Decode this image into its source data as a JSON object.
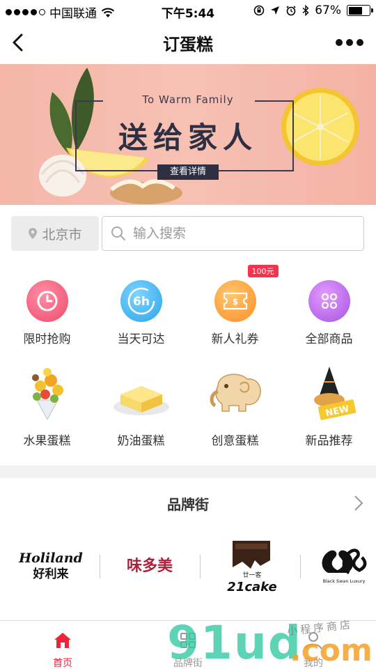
{
  "status": {
    "carrier": "中国联通",
    "time": "下午5:44",
    "battery": "67%",
    "battery_level": 0.67
  },
  "nav": {
    "title": "订蛋糕"
  },
  "banner": {
    "en": "To Warm Family",
    "cn": "送给家人",
    "button": "查看详情"
  },
  "search": {
    "city": "北京市",
    "placeholder": "输入搜索"
  },
  "categories": [
    {
      "label": "限时抢购",
      "icon": "clock-icon",
      "color": "#f25d7a"
    },
    {
      "label": "当天可达",
      "icon": "6h-icon",
      "color": "#3ab4ee",
      "icon_text": "6h"
    },
    {
      "label": "新人礼券",
      "icon": "coupon-icon",
      "color": "#ff9f3a",
      "badge": "100元"
    },
    {
      "label": "全部商品",
      "icon": "grid-dots-icon",
      "color": "#b45ee8"
    },
    {
      "label": "水果蛋糕",
      "icon": "fruit-bouquet-icon"
    },
    {
      "label": "奶油蛋糕",
      "icon": "cream-cake-icon"
    },
    {
      "label": "创意蛋糕",
      "icon": "elephant-cookie-icon"
    },
    {
      "label": "新品推荐",
      "icon": "new-cake-icon",
      "badge_text": "NEW"
    }
  ],
  "brand": {
    "title": "品牌街",
    "logos": [
      {
        "name": "Holiland",
        "sub": "好利来"
      },
      {
        "name": "味多美"
      },
      {
        "name": "21cake",
        "sub": "廿一客"
      },
      {
        "name": "Black Swan Luxury"
      }
    ]
  },
  "tabs": [
    {
      "label": "首页",
      "icon": "home-icon",
      "active": true
    },
    {
      "label": "品牌街",
      "icon": "brand-icon",
      "active": false
    },
    {
      "label": "我的",
      "icon": "user-icon",
      "active": false
    }
  ],
  "watermark": {
    "main": "91ud",
    "dot": ".com",
    "small": "小程序商店"
  }
}
